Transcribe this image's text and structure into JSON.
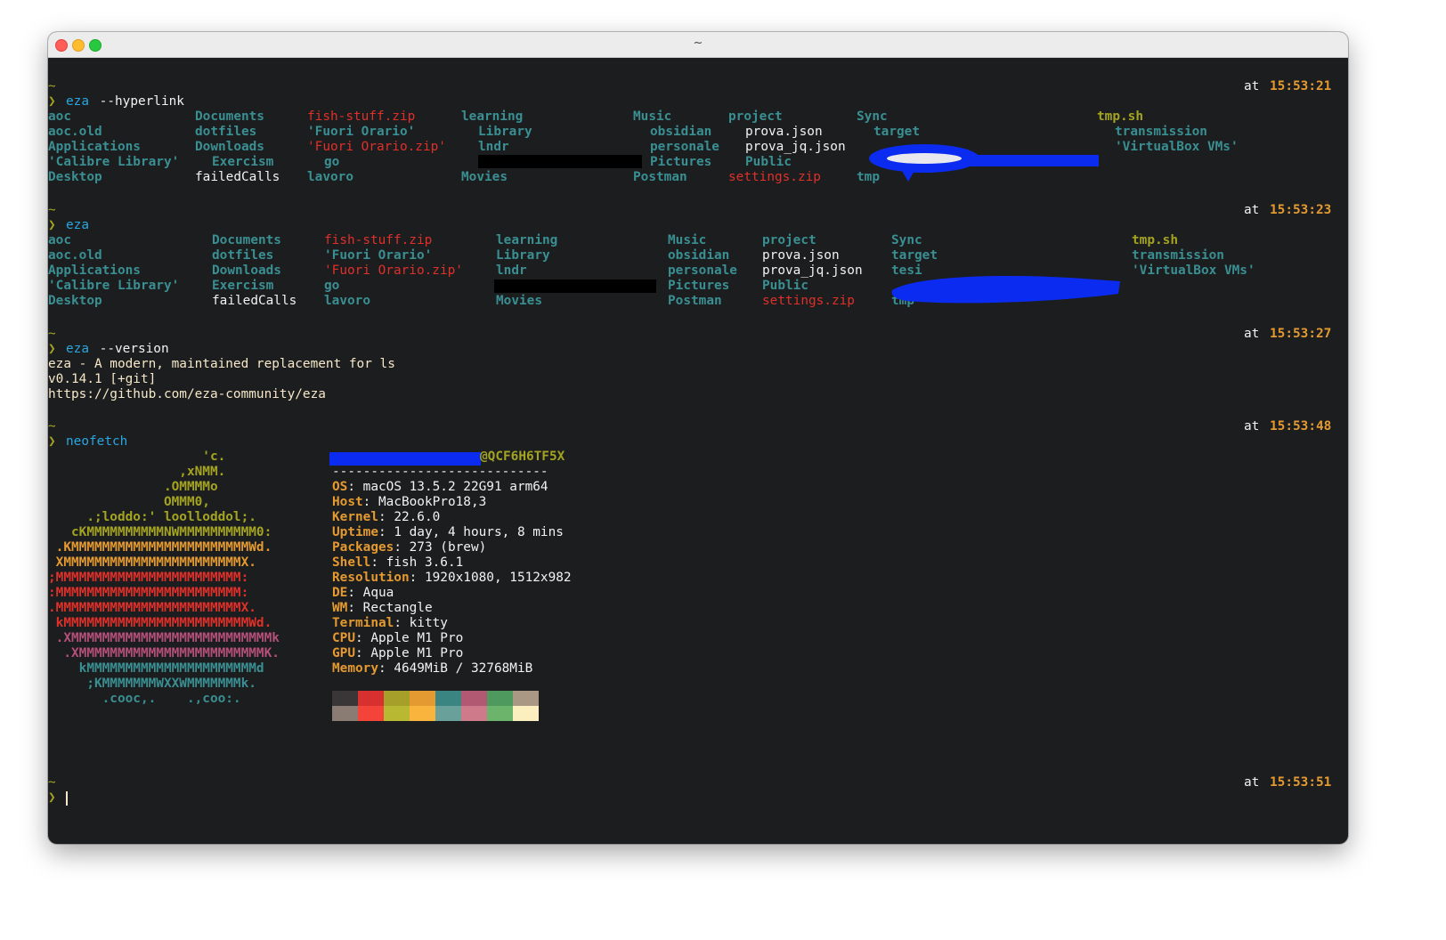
{
  "window": {
    "title": "~"
  },
  "session": [
    {
      "tilde": "~",
      "time_prefix": "at ",
      "time": "15:53:21",
      "prompt": "❯",
      "command": "eza",
      "args": " --hyperlink",
      "listing": [
        [
          "aoc",
          "aoc.old",
          "Applications",
          "'Calibre Library'",
          "Desktop"
        ],
        [
          "Documents",
          "dotfiles",
          "Downloads",
          "Exercism",
          "failedCalls"
        ],
        [
          "fish-stuff.zip",
          "'Fuori Orario'",
          "'Fuori Orario.zip'",
          "go",
          "lavoro"
        ],
        [
          "learning",
          "Library",
          "lndr",
          "",
          "Movies"
        ],
        [
          "Music",
          "obsidian",
          "personale",
          "Pictures",
          "Postman"
        ],
        [
          "project",
          "prova.json",
          "prova_jq.json",
          "Public",
          "settings.zip"
        ],
        [
          "Sync",
          "target",
          "",
          "",
          "tmp"
        ],
        [
          "tmp.sh",
          "transmission",
          "'VirtualBox VMs'"
        ]
      ]
    },
    {
      "tilde": "~",
      "time_prefix": "at ",
      "time": "15:53:23",
      "prompt": "❯",
      "command": "eza",
      "listing": [
        [
          "aoc",
          "aoc.old",
          "Applications",
          "'Calibre Library'",
          "Desktop"
        ],
        [
          "Documents",
          "dotfiles",
          "Downloads",
          "Exercism",
          "failedCalls"
        ],
        [
          "fish-stuff.zip",
          "'Fuori Orario'",
          "'Fuori Orario.zip'",
          "go",
          "lavoro"
        ],
        [
          "learning",
          "Library",
          "lndr",
          "",
          "Movies"
        ],
        [
          "Music",
          "obsidian",
          "personale",
          "Pictures",
          "Postman"
        ],
        [
          "project",
          "prova.json",
          "prova_jq.json",
          "Public",
          "settings.zip"
        ],
        [
          "Sync",
          "target",
          "tesi",
          "",
          "tmp"
        ],
        [
          "tmp.sh",
          "transmission",
          "'VirtualBox VMs'"
        ]
      ]
    },
    {
      "tilde": "~",
      "time_prefix": "at ",
      "time": "15:53:27",
      "prompt": "❯",
      "command": "eza",
      "args": " --version",
      "output": [
        "eza - A modern, maintained replacement for ls",
        "v0.14.1 [+git]",
        "https://github.com/eza-community/eza"
      ]
    },
    {
      "tilde": "~",
      "time_prefix": "at ",
      "time": "15:53:48",
      "prompt": "❯",
      "command": "neofetch"
    },
    {
      "tilde": "~",
      "time_prefix": "at ",
      "time": "15:53:51",
      "prompt": "❯"
    }
  ],
  "neofetch": {
    "logo": [
      {
        "text": "                    'c.",
        "color": "#a4a421"
      },
      {
        "text": "                 ,xNMM.",
        "color": "#a4a421"
      },
      {
        "text": "               .OMMMMo",
        "color": "#a4a421"
      },
      {
        "text": "               OMMM0,",
        "color": "#a4a421"
      },
      {
        "text": "     .;loddo:' loolloddol;.",
        "color": "#a4a421"
      },
      {
        "text": "   cKMMMMMMMMMMNWMMMMMMMMMM0:",
        "color": "#a4a421"
      },
      {
        "text": " .KMMMMMMMMMMMMMMMMMMMMMMMWd.",
        "color": "#e49a30"
      },
      {
        "text": " XMMMMMMMMMMMMMMMMMMMMMMMX.",
        "color": "#e49a30"
      },
      {
        "text": ";MMMMMMMMMMMMMMMMMMMMMMMM:",
        "color": "#e0302a"
      },
      {
        "text": ":MMMMMMMMMMMMMMMMMMMMMMMM:",
        "color": "#e0302a"
      },
      {
        "text": ".MMMMMMMMMMMMMMMMMMMMMMMMX.",
        "color": "#e0302a"
      },
      {
        "text": " kMMMMMMMMMMMMMMMMMMMMMMMMWd.",
        "color": "#e0302a"
      },
      {
        "text": " .XMMMMMMMMMMMMMMMMMMMMMMMMMMk",
        "color": "#b4507a"
      },
      {
        "text": "  .XMMMMMMMMMMMMMMMMMMMMMMMMK.",
        "color": "#b4507a"
      },
      {
        "text": "    kMMMMMMMMMMMMMMMMMMMMMMd",
        "color": "#3a8f92"
      },
      {
        "text": "     ;KMMMMMMMWXXWMMMMMMMk.",
        "color": "#3a8f92"
      },
      {
        "text": "       .cooc,.    .,coo:.",
        "color": "#3a8f92"
      }
    ],
    "host_suffix": "@QCF6H6TF5X",
    "separator": "----------------------------",
    "info": [
      {
        "label": "OS",
        "value": " macOS 13.5.2 22G91 arm64"
      },
      {
        "label": "Host",
        "value": " MacBookPro18,3"
      },
      {
        "label": "Kernel",
        "value": " 22.6.0"
      },
      {
        "label": "Uptime",
        "value": " 1 day, 4 hours, 8 mins"
      },
      {
        "label": "Packages",
        "value": " 273 (brew)"
      },
      {
        "label": "Shell",
        "value": " fish 3.6.1"
      },
      {
        "label": "Resolution",
        "value": " 1920x1080, 1512x982"
      },
      {
        "label": "DE",
        "value": " Aqua"
      },
      {
        "label": "WM",
        "value": " Rectangle"
      },
      {
        "label": "Terminal",
        "value": " kitty"
      },
      {
        "label": "CPU",
        "value": " Apple M1 Pro"
      },
      {
        "label": "GPU",
        "value": " Apple M1 Pro"
      },
      {
        "label": "Memory",
        "value": " 4649MiB / 32768MiB"
      }
    ],
    "colors_dark": [
      "#3a3638",
      "#d8302e",
      "#a6a02a",
      "#e49a30",
      "#3a8482",
      "#b15873",
      "#4e9a5e",
      "#a89884"
    ],
    "colors_bright": [
      "#8a7c72",
      "#f4443a",
      "#b8b832",
      "#f8b43c",
      "#6aa09a",
      "#cf7a8a",
      "#6cb36c",
      "#fbefbf"
    ]
  }
}
